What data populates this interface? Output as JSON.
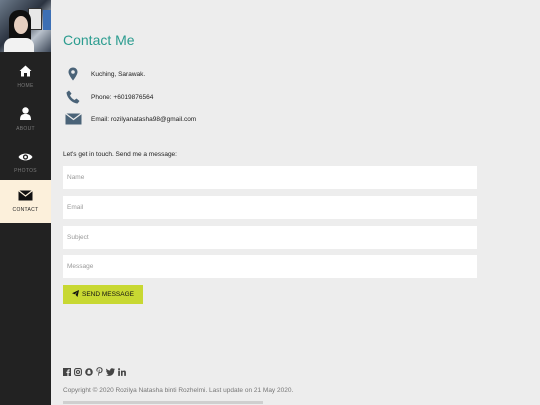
{
  "nav": {
    "items": [
      {
        "label": "HOME",
        "icon": "home-icon"
      },
      {
        "label": "ABOUT",
        "icon": "user-icon"
      },
      {
        "label": "PHOTOS",
        "icon": "eye-icon"
      },
      {
        "label": "CONTACT",
        "icon": "envelope-icon"
      }
    ],
    "active": "CONTACT"
  },
  "page": {
    "title": "Contact Me"
  },
  "contact_info": {
    "location": "Kuching, Sarawak.",
    "phone": "Phone: +6019876564",
    "email": "Email: rozilyanatasha98@gmail.com"
  },
  "form": {
    "intro": "Let's get in touch. Send me a message:",
    "name_placeholder": "Name",
    "email_placeholder": "Email",
    "subject_placeholder": "Subject",
    "message_placeholder": "Message",
    "submit_label": "SEND MESSAGE"
  },
  "footer": {
    "social_icons": [
      "facebook-icon",
      "instagram-icon",
      "snapchat-icon",
      "pinterest-icon",
      "twitter-icon",
      "linkedin-icon"
    ],
    "copyright": "Copyright © 2020 Rozilya Natasha binti Rozhelmi. Last update on 21 May 2020."
  },
  "colors": {
    "sidebar_bg": "#222222",
    "active_nav_bg": "#fcf0db",
    "title": "#2b9c8f",
    "button_bg": "#c8d832",
    "page_bg": "#ededed"
  }
}
